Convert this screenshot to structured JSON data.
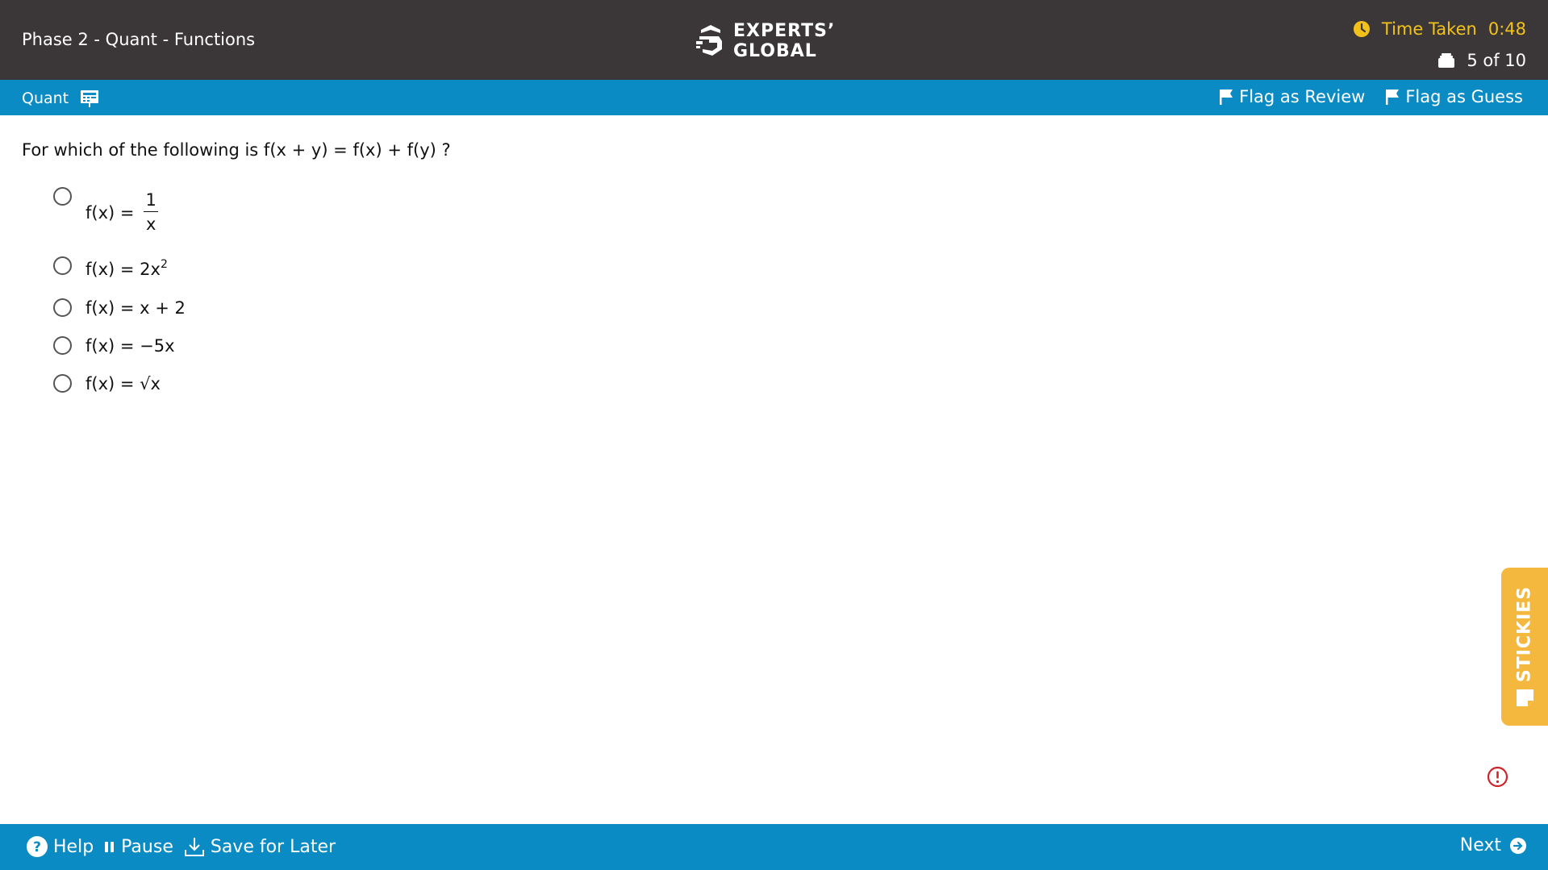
{
  "header": {
    "title": "Phase 2 - Quant - Functions",
    "logo_line1": "EXPERTS’",
    "logo_line2": "GLOBAL",
    "time_label": "Time Taken",
    "time_value": "0:48",
    "question_count": "5 of 10"
  },
  "subbar": {
    "section": "Quant",
    "flag_review": "Flag as Review",
    "flag_guess": "Flag as Guess"
  },
  "question": {
    "text": "For which of the following is f(x + y) = f(x) + f(y) ?",
    "options": [
      {
        "prefix": "f(x) =",
        "numerator": "1",
        "denominator": "x"
      },
      {
        "text": "f(x) = 2x",
        "sup": "2"
      },
      {
        "text": "f(x) = x + 2"
      },
      {
        "text": "f(x) = −5x"
      },
      {
        "text": "f(x) = √x"
      }
    ]
  },
  "stickies": {
    "label": "STICKIES"
  },
  "footer": {
    "help": "Help",
    "pause": "Pause",
    "save": "Save for Later",
    "next": "Next"
  },
  "colors": {
    "header_bg": "#3b3738",
    "bar_blue": "#0b8bc3",
    "timer_yellow": "#f2c21b",
    "stickies_orange": "#f5b83e",
    "alert_red": "#d0242b"
  },
  "icons": [
    "logo-icon",
    "clock-icon",
    "question-stack-icon",
    "calculator-icon",
    "flag-icon",
    "sticky-note-icon",
    "alert-icon",
    "help-icon",
    "pause-icon",
    "download-icon",
    "arrow-right-icon"
  ]
}
